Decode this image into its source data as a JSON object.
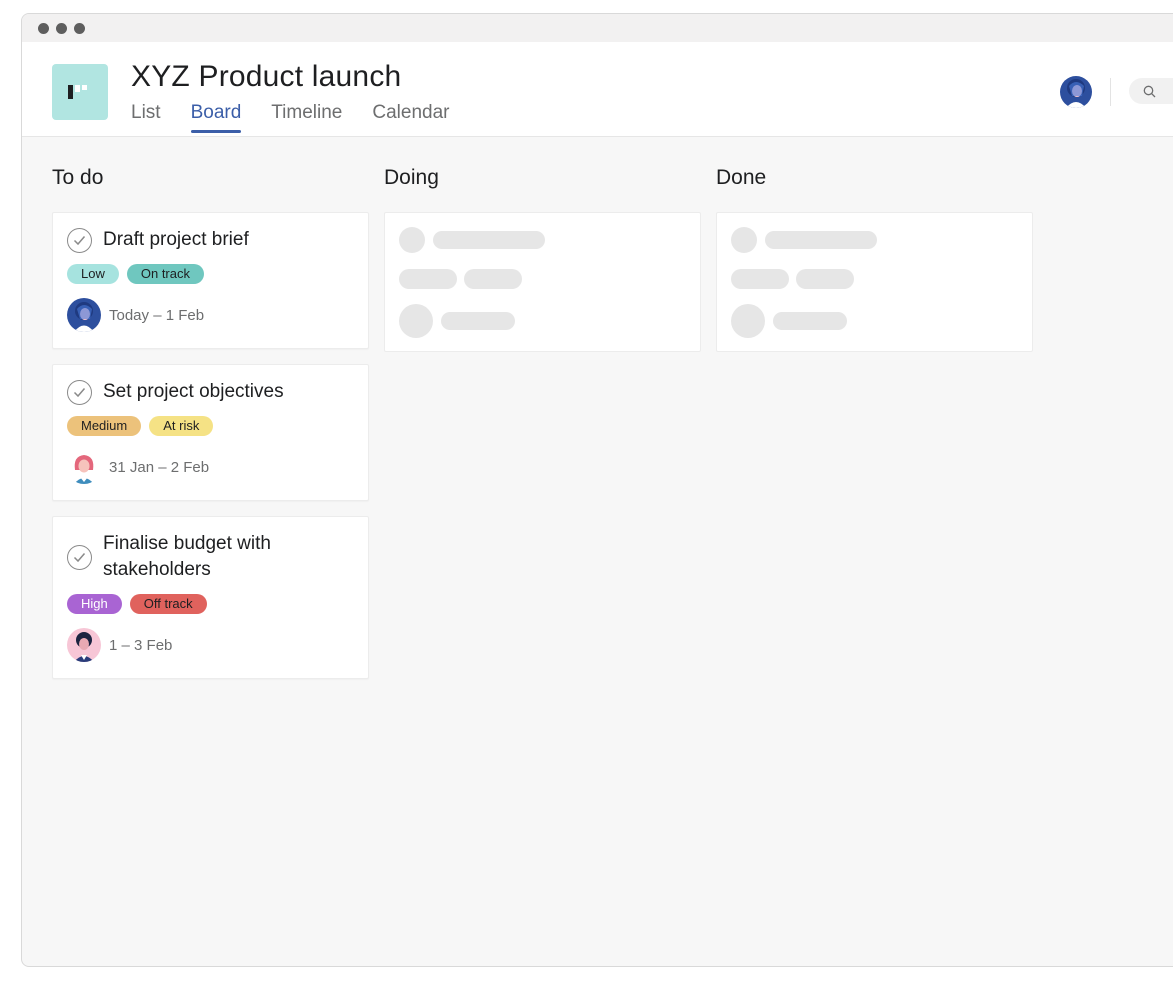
{
  "project": {
    "title": "XYZ Product launch",
    "icon": "board-project-icon",
    "icon_color": "#b1e5e1"
  },
  "tabs": [
    {
      "label": "List",
      "active": false
    },
    {
      "label": "Board",
      "active": true
    },
    {
      "label": "Timeline",
      "active": false
    },
    {
      "label": "Calendar",
      "active": false
    }
  ],
  "header": {
    "search_icon": "search-icon"
  },
  "columns": [
    {
      "title": "To do",
      "cards": [
        {
          "title": "Draft project brief",
          "tags": [
            {
              "label": "Low",
              "color": "#a6e3df"
            },
            {
              "label": "On track",
              "color": "#6fc7bf"
            }
          ],
          "date": "Today – 1 Feb"
        },
        {
          "title": "Set project objectives",
          "tags": [
            {
              "label": "Medium",
              "color": "#ecc27b"
            },
            {
              "label": "At risk",
              "color": "#f5e285"
            }
          ],
          "date": "31 Jan – 2 Feb"
        },
        {
          "title": "Finalise budget with stakeholders",
          "tags": [
            {
              "label": "High",
              "color": "#a964d3"
            },
            {
              "label": "Off track",
              "color": "#e0625d"
            }
          ],
          "date": "1 – 3 Feb"
        }
      ]
    },
    {
      "title": "Doing",
      "cards": []
    },
    {
      "title": "Done",
      "cards": []
    }
  ],
  "colors": {
    "accent": "#3b5ea8",
    "background": "#f7f7f7",
    "skeleton": "#e6e6e6"
  }
}
